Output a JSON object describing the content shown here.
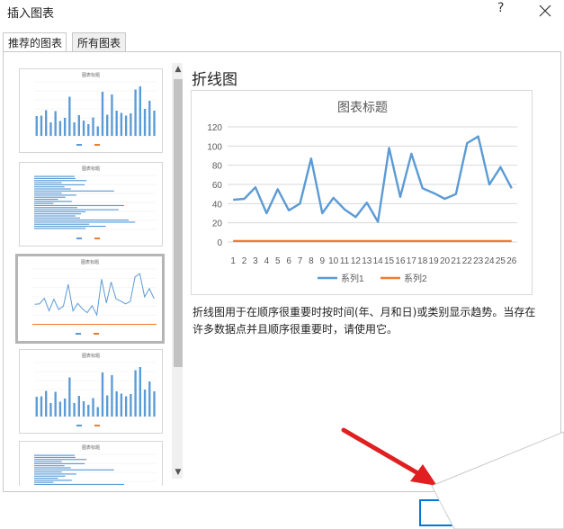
{
  "dialog": {
    "title": "插入图表",
    "help_label": "?",
    "close_icon": "close-icon"
  },
  "tabs": [
    {
      "label": "推荐的图表",
      "active": true
    },
    {
      "label": "所有图表",
      "active": false
    }
  ],
  "thumbnails": [
    {
      "title": "图表标题",
      "kind": "clustered-column",
      "selected": false
    },
    {
      "title": "图表标题",
      "kind": "clustered-bar",
      "selected": false
    },
    {
      "title": "图表标题",
      "kind": "line",
      "selected": true
    },
    {
      "title": "图表标题",
      "kind": "clustered-column",
      "selected": false
    },
    {
      "title": "图表标题",
      "kind": "clustered-bar",
      "selected": false
    }
  ],
  "preview": {
    "type_name": "折线图",
    "description": "折线图用于在顺序很重要时按时间(年、月和日)或类别显示趋势。当存在许多数据点并且顺序很重要时，请使用它。"
  },
  "chart_data": {
    "type": "line",
    "title": "图表标题",
    "categories": [
      "1",
      "2",
      "3",
      "4",
      "5",
      "6",
      "7",
      "8",
      "9",
      "10",
      "11",
      "12",
      "13",
      "14",
      "15",
      "16",
      "17",
      "18",
      "19",
      "20",
      "21",
      "22",
      "23",
      "24",
      "25",
      "26"
    ],
    "series": [
      {
        "name": "系列1",
        "color": "#5b9bd5",
        "values": [
          44,
          45,
          57,
          30,
          55,
          33,
          40,
          87,
          30,
          46,
          34,
          26,
          41,
          21,
          98,
          47,
          92,
          56,
          51,
          45,
          50,
          103,
          110,
          60,
          78,
          56
        ]
      },
      {
        "name": "系列2",
        "color": "#ed7d31",
        "values": [
          1,
          1,
          1,
          1,
          1,
          1,
          1,
          1,
          1,
          1,
          1,
          1,
          1,
          1,
          1,
          1,
          1,
          1,
          1,
          1,
          1,
          1,
          1,
          1,
          1,
          1
        ]
      }
    ],
    "yticks": [
      "0",
      "20",
      "40",
      "60",
      "80",
      "100",
      "120"
    ],
    "ylim": [
      0,
      120
    ],
    "grid": true,
    "legend": "bottom"
  }
}
